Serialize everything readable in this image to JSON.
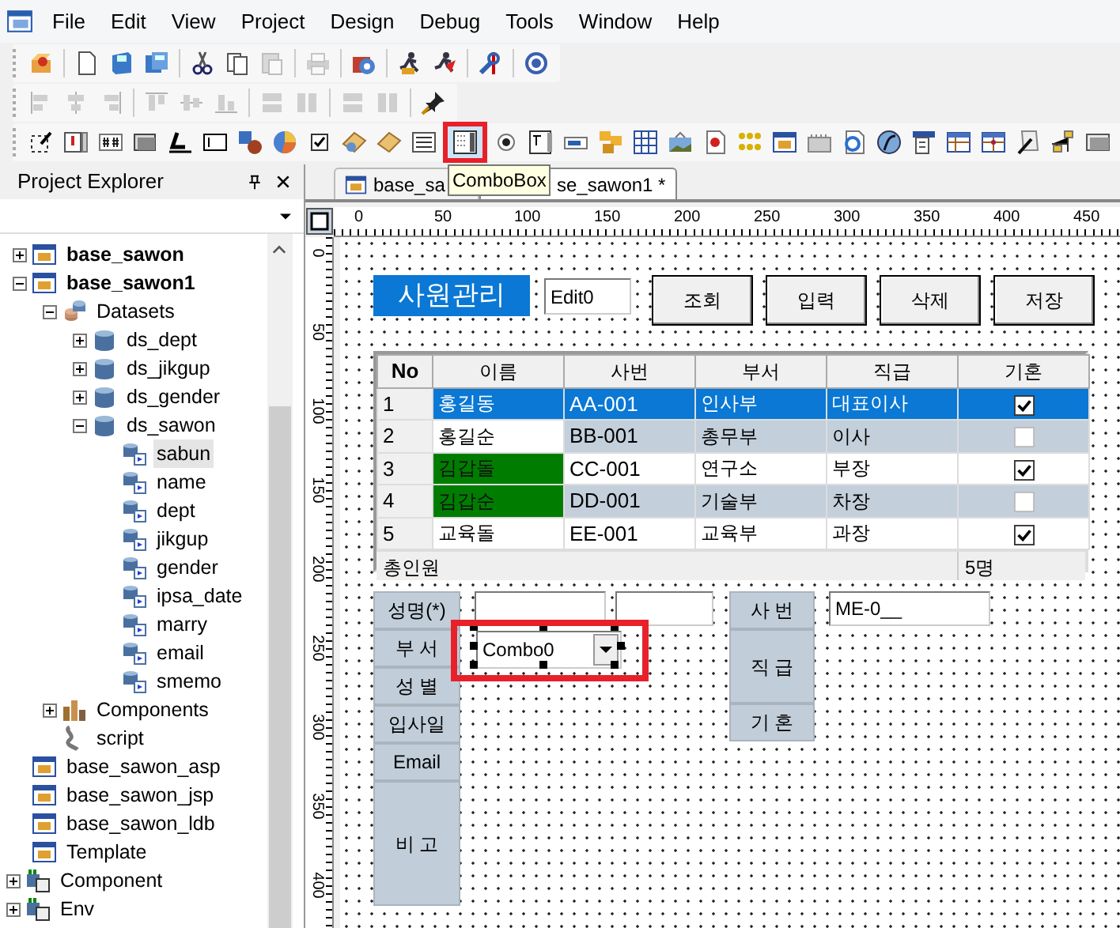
{
  "menu": [
    {
      "label": "File"
    },
    {
      "label": "Edit"
    },
    {
      "label": "View"
    },
    {
      "label": "Project"
    },
    {
      "label": "Design"
    },
    {
      "label": "Debug"
    },
    {
      "label": "Tools"
    },
    {
      "label": "Window"
    },
    {
      "label": "Help"
    }
  ],
  "tooltip": "ComboBox",
  "project_explorer": {
    "title": "Project Explorer",
    "tree": [
      {
        "children": [
          {
            "label": "base_sawon",
            "kind": "form",
            "bold": true,
            "expanded": false,
            "selected": false
          },
          {
            "label": "base_sawon1",
            "kind": "form",
            "bold": true,
            "expanded": true,
            "selected": false,
            "children": [
              {
                "label": "Datasets",
                "kind": "datasets",
                "expanded": true,
                "selected": false,
                "children": [
                  {
                    "label": "ds_dept",
                    "kind": "dataset",
                    "expanded": false,
                    "selected": false
                  },
                  {
                    "label": "ds_jikgup",
                    "kind": "dataset",
                    "expanded": false,
                    "selected": false
                  },
                  {
                    "label": "ds_gender",
                    "kind": "dataset",
                    "expanded": false,
                    "selected": false
                  },
                  {
                    "label": "ds_sawon",
                    "kind": "dataset",
                    "expanded": true,
                    "selected": false,
                    "children": [
                      {
                        "label": "sabun",
                        "kind": "column",
                        "selected": true
                      },
                      {
                        "label": "name",
                        "kind": "column",
                        "selected": false
                      },
                      {
                        "label": "dept",
                        "kind": "column",
                        "selected": false
                      },
                      {
                        "label": "jikgup",
                        "kind": "column",
                        "selected": false
                      },
                      {
                        "label": "gender",
                        "kind": "column",
                        "selected": false
                      },
                      {
                        "label": "ipsa_date",
                        "kind": "column",
                        "selected": false
                      },
                      {
                        "label": "marry",
                        "kind": "column",
                        "selected": false
                      },
                      {
                        "label": "email",
                        "kind": "column",
                        "selected": false
                      },
                      {
                        "label": "smemo",
                        "kind": "column",
                        "selected": false
                      }
                    ]
                  }
                ]
              },
              {
                "label": "Components",
                "kind": "components",
                "expanded": false,
                "selected": false
              },
              {
                "label": "script",
                "kind": "script",
                "selected": false
              }
            ]
          },
          {
            "label": "base_sawon_asp",
            "kind": "form",
            "bold": false,
            "selected": false
          },
          {
            "label": "base_sawon_jsp",
            "kind": "form",
            "bold": false,
            "selected": false
          },
          {
            "label": "base_sawon_ldb",
            "kind": "form",
            "bold": false,
            "selected": false
          },
          {
            "label": "Template",
            "kind": "form",
            "bold": false,
            "selected": false
          }
        ]
      },
      {
        "label": "Component",
        "kind": "group",
        "expanded": false,
        "selected": false
      },
      {
        "label": "Env",
        "kind": "group",
        "expanded": false,
        "selected": false
      }
    ]
  },
  "tabs": [
    {
      "label": "base_sa",
      "selected": false
    },
    {
      "label": "se_sawon1 *",
      "selected": true
    }
  ],
  "ruler": {
    "x_labels": [
      "0",
      "50",
      "100",
      "150",
      "200",
      "250",
      "300",
      "350",
      "400",
      "450"
    ],
    "y_labels": [
      "0",
      "50",
      "100",
      "150",
      "200",
      "250",
      "300",
      "350",
      "400"
    ]
  },
  "form": {
    "title": "사원관리",
    "edit_value": "Edit0",
    "buttons": [
      "조회",
      "입력",
      "삭제",
      "저장"
    ],
    "grid": {
      "columns": [
        "No",
        "이름",
        "사번",
        "부서",
        "직급",
        "기혼"
      ],
      "rows": [
        {
          "no": "1",
          "name": "홍길동",
          "sabun": "AA-001",
          "dept": "인사부",
          "jikgup": "대표이사",
          "married": true,
          "selected": true,
          "name_highlight": false
        },
        {
          "no": "2",
          "name": "홍길순",
          "sabun": "BB-001",
          "dept": "총무부",
          "jikgup": "이사",
          "married": false,
          "selected": false,
          "name_highlight": false
        },
        {
          "no": "3",
          "name": "김갑돌",
          "sabun": "CC-001",
          "dept": "연구소",
          "jikgup": "부장",
          "married": true,
          "selected": false,
          "name_highlight": true
        },
        {
          "no": "4",
          "name": "김갑순",
          "sabun": "DD-001",
          "dept": "기술부",
          "jikgup": "차장",
          "married": false,
          "selected": false,
          "name_highlight": true
        },
        {
          "no": "5",
          "name": "교육돌",
          "sabun": "EE-001",
          "dept": "교육부",
          "jikgup": "과장",
          "married": true,
          "selected": false,
          "name_highlight": false
        }
      ],
      "footer": {
        "label": "총인원",
        "count": "5명"
      }
    },
    "left_labels": [
      "성명(*)",
      "부 서",
      "성 별",
      "입사일",
      "Email",
      "비 고"
    ],
    "right_labels": [
      "사 번",
      "직 급",
      "기 혼"
    ],
    "combo": {
      "value": "Combo0",
      "selected": true
    },
    "sabun_value": "ME-0__"
  }
}
